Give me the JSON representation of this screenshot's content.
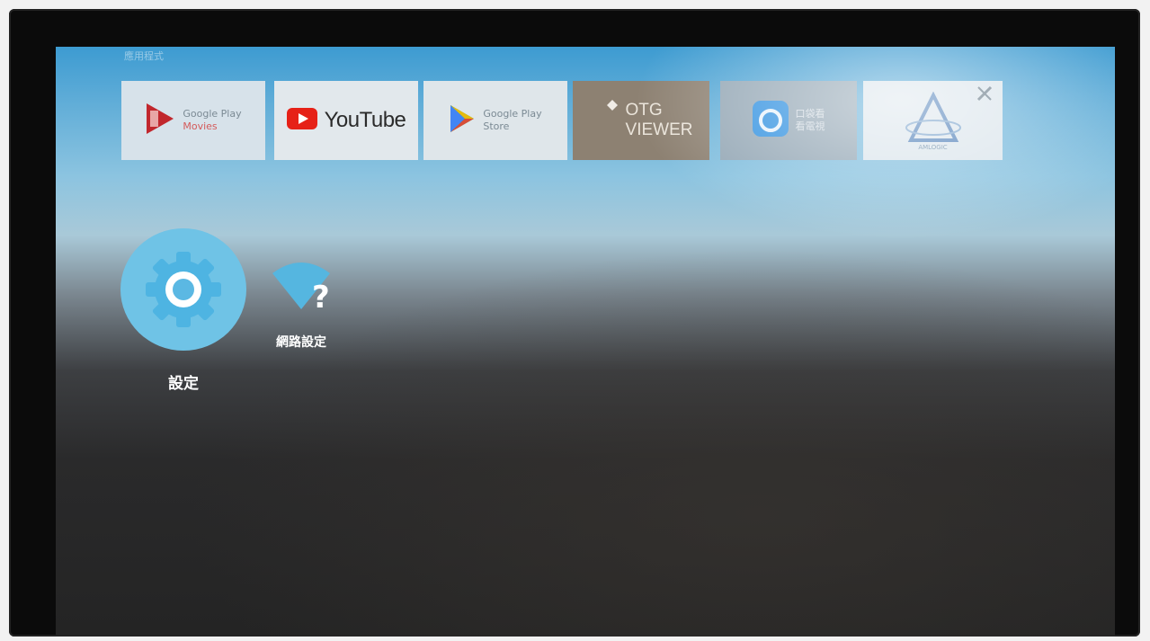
{
  "row_title": "應用程式",
  "tiles": [
    {
      "name": "google-play-movies",
      "line1": "Google Play",
      "line2": "Movies"
    },
    {
      "name": "youtube",
      "label": "YouTube"
    },
    {
      "name": "google-play-store",
      "line1": "Google Play",
      "line2": "Store"
    },
    {
      "name": "otg-viewer",
      "line1": "OTG",
      "line2": "VIEWER"
    },
    {
      "name": "hk-tile",
      "line1": "口袋看",
      "line2": "看電視"
    },
    {
      "name": "amlogic",
      "label": "AMLOGIC"
    }
  ],
  "apps": {
    "settings": {
      "label": "設定",
      "icon": "settings-gear-icon"
    },
    "network": {
      "label": "網路設定",
      "icon": "wifi-question-icon"
    }
  },
  "colors": {
    "settings_circle": "#6fc3e6",
    "youtube_red": "#e62117",
    "play_red": "#c1272d"
  }
}
